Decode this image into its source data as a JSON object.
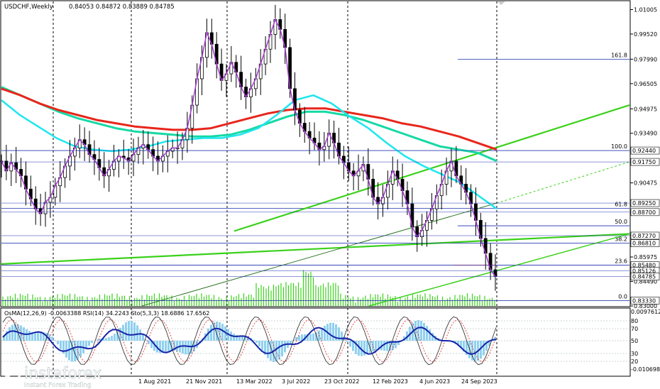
{
  "header": {
    "symbol": "USDCHF,Weekly",
    "ohlc": "0.84053 0.84872 0.83889 0.84785"
  },
  "indicator_header": "OsMA(12,26,9) -0.0063388 RSI(14) 34.2243 Sto(5,3,3) 18.6886 17.6562",
  "branding": {
    "logo_text": "instaforex",
    "tagline": "Instant Forex Trading"
  },
  "colors": {
    "candles": "#000000",
    "ema_red": "#e8251b",
    "ema_teal": "#16d9a5",
    "ema_cyan": "#1ee6ef",
    "ema_purple": "#a43bd0",
    "channel_green": "#3ad11a",
    "fib_blue": "#1d2fb0",
    "osma_bars": "#8fd0ef",
    "rsi_line": "#1624a8",
    "sto_main": "#222222",
    "sto_signal": "#e02020",
    "grid": "#000000"
  },
  "chart_data": {
    "type": "line",
    "title": "USDCHF,Weekly",
    "price_ticks": [
      "1.01005",
      "0.99520",
      "0.97990",
      "0.96505",
      "0.94975",
      "0.93490",
      "0.91750",
      "0.90475",
      "0.88700",
      "0.87270",
      "0.86810",
      "0.85975",
      "0.84490",
      "0.83000"
    ],
    "price_range": [
      0.83,
      1.015
    ],
    "highlighted_levels": [
      {
        "label": "0.92440",
        "value": 0.9244
      },
      {
        "label": "0.91750",
        "value": 0.9175
      },
      {
        "label": "0.89250",
        "value": 0.8925
      },
      {
        "label": "0.88700",
        "value": 0.887
      },
      {
        "label": "0.87270",
        "value": 0.8727
      },
      {
        "label": "0.86810",
        "value": 0.8681
      },
      {
        "label": "0.85480",
        "value": 0.8548
      },
      {
        "label": "0.85126",
        "value": 0.85126
      },
      {
        "label": "0.84785",
        "value": 0.84785
      },
      {
        "label": "0.83330",
        "value": 0.8333
      }
    ],
    "fibonacci_levels": [
      {
        "label": "161.8",
        "value": 0.9799
      },
      {
        "label": "100.0",
        "value": 0.9244
      },
      {
        "label": "61.8",
        "value": 0.8893
      },
      {
        "label": "50.0",
        "value": 0.8787
      },
      {
        "label": "38.2",
        "value": 0.8681
      },
      {
        "label": "23.6",
        "value": 0.8548
      },
      {
        "label": "0.0",
        "value": 0.8333
      }
    ],
    "date_labels": [
      "1 Aug 2021",
      "21 Nov 2021",
      "13 Mar 2022",
      "3 Jul 2022",
      "23 Oct 2022",
      "12 Feb 2023",
      "4 Jun 2023",
      "24 Sep 2023"
    ],
    "series": [
      {
        "name": "Price",
        "values": [
          0.918,
          0.912,
          0.917,
          0.913,
          0.909,
          0.901,
          0.895,
          0.889,
          0.886,
          0.893,
          0.896,
          0.903,
          0.908,
          0.915,
          0.921,
          0.926,
          0.931,
          0.928,
          0.922,
          0.919,
          0.914,
          0.909,
          0.913,
          0.918,
          0.921,
          0.92,
          0.918,
          0.922,
          0.926,
          0.928,
          0.925,
          0.921,
          0.918,
          0.921,
          0.924,
          0.926,
          0.926,
          0.931,
          0.938,
          0.952,
          0.968,
          0.981,
          0.996,
          0.989,
          0.977,
          0.967,
          0.971,
          0.978,
          0.972,
          0.963,
          0.957,
          0.962,
          0.968,
          0.977,
          0.986,
          0.995,
          1.004,
          0.998,
          0.987,
          0.962,
          0.949,
          0.941,
          0.936,
          0.932,
          0.929,
          0.925,
          0.927,
          0.935,
          0.929,
          0.921,
          0.917,
          0.912,
          0.909,
          0.912,
          0.916,
          0.907,
          0.896,
          0.892,
          0.896,
          0.904,
          0.912,
          0.907,
          0.9,
          0.892,
          0.878,
          0.872,
          0.876,
          0.882,
          0.889,
          0.897,
          0.904,
          0.912,
          0.918,
          0.909,
          0.904,
          0.899,
          0.892,
          0.882,
          0.871,
          0.862,
          0.852,
          0.848
        ]
      },
      {
        "name": "EMA 200",
        "values": [
          0.962,
          0.958,
          0.953,
          0.949,
          0.946,
          0.943,
          0.941,
          0.939,
          0.938,
          0.937,
          0.937,
          0.938,
          0.941,
          0.944,
          0.947,
          0.949,
          0.95,
          0.95,
          0.948,
          0.946,
          0.944,
          0.941,
          0.939,
          0.936,
          0.933,
          0.929,
          0.925
        ]
      },
      {
        "name": "EMA 144",
        "values": [
          0.963,
          0.958,
          0.953,
          0.948,
          0.944,
          0.941,
          0.938,
          0.936,
          0.935,
          0.934,
          0.933,
          0.933,
          0.934,
          0.937,
          0.941,
          0.945,
          0.948,
          0.948,
          0.946,
          0.943,
          0.939,
          0.935,
          0.931,
          0.927,
          0.925,
          0.923,
          0.918
        ]
      },
      {
        "name": "EMA 50",
        "values": [
          0.955,
          0.946,
          0.939,
          0.932,
          0.927,
          0.925,
          0.924,
          0.925,
          0.927,
          0.93,
          0.931,
          0.932,
          0.932,
          0.934,
          0.938,
          0.946,
          0.955,
          0.958,
          0.953,
          0.945,
          0.938,
          0.929,
          0.921,
          0.915,
          0.91,
          0.905,
          0.897,
          0.889
        ]
      },
      {
        "name": "Channel upper",
        "values": [
          0.852,
          0.952
        ]
      },
      {
        "name": "Channel lower",
        "values": [
          0.829,
          0.875
        ]
      }
    ],
    "indicator_ticks": [
      "0.0097612",
      "80",
      "70",
      "50",
      "30",
      "20",
      "-0.010698"
    ]
  }
}
